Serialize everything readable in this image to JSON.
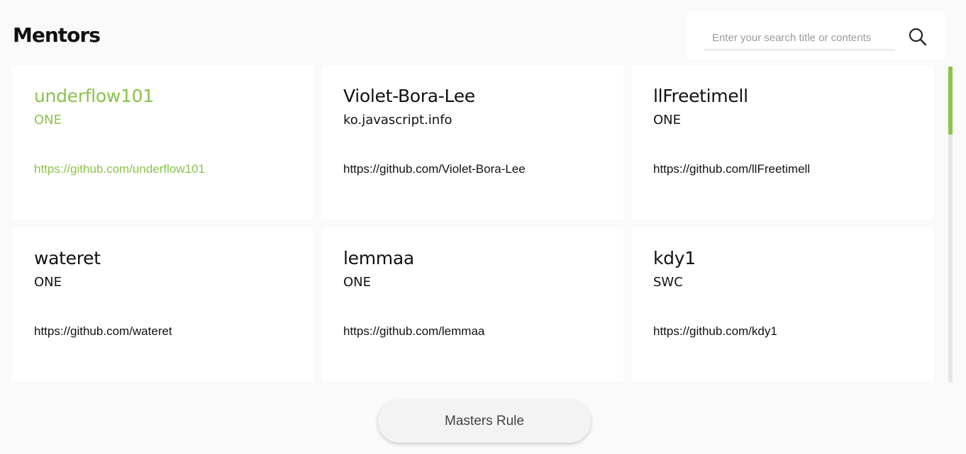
{
  "header": {
    "title": "Mentors"
  },
  "search": {
    "placeholder": "Enter your search title or contents",
    "value": "",
    "icon": "search-icon"
  },
  "mentors": [
    {
      "name": "underflow101",
      "org": "ONE",
      "link": "https://github.com/underflow101",
      "active": true
    },
    {
      "name": "Violet-Bora-Lee",
      "org": "ko.javascript.info",
      "link": "https://github.com/Violet-Bora-Lee",
      "active": false
    },
    {
      "name": "llFreetimell",
      "org": "ONE",
      "link": "https://github.com/llFreetimell",
      "active": false
    },
    {
      "name": "wateret",
      "org": "ONE",
      "link": "https://github.com/wateret",
      "active": false
    },
    {
      "name": "lemmaa",
      "org": "ONE",
      "link": "https://github.com/lemmaa",
      "active": false
    },
    {
      "name": "kdy1",
      "org": "SWC",
      "link": "https://github.com/kdy1",
      "active": false
    }
  ],
  "footer": {
    "button_label": "Masters Rule"
  },
  "colors": {
    "accent": "#8bc34a",
    "background": "#fafafa",
    "card": "#ffffff"
  }
}
